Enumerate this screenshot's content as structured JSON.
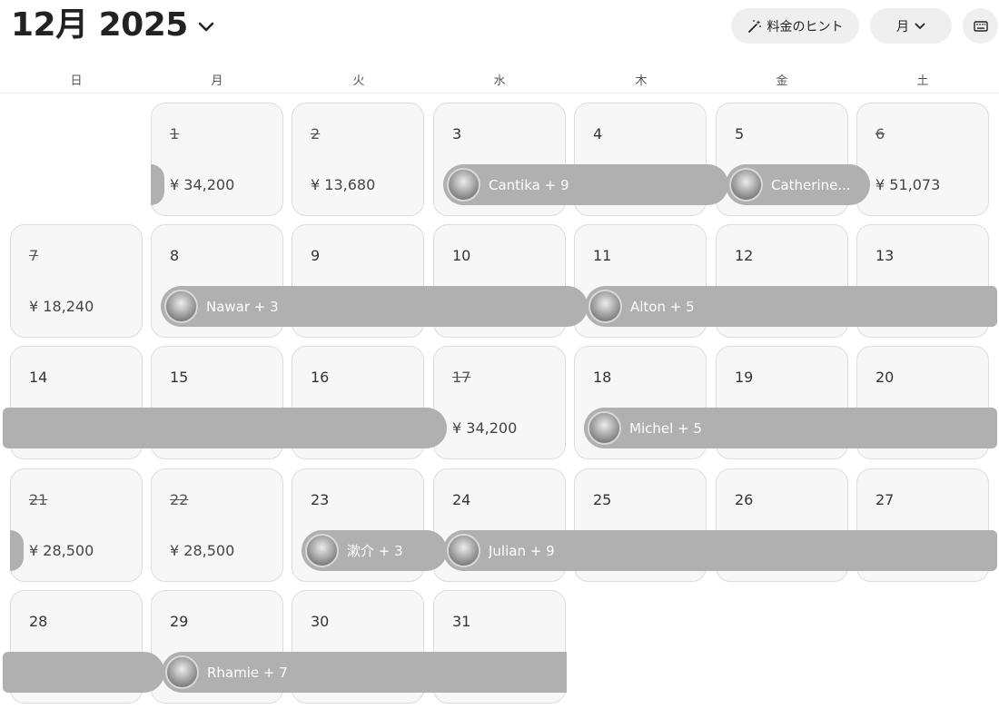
{
  "header": {
    "month_title": "12月 2025",
    "hint_button": "料金のヒント",
    "view_select": "月"
  },
  "weekdays": [
    "日",
    "月",
    "火",
    "水",
    "木",
    "金",
    "土"
  ],
  "days": [
    {
      "day": "1",
      "price": "¥ 34,200",
      "struck": true
    },
    {
      "day": "2",
      "price": "¥ 13,680",
      "struck": true
    },
    {
      "day": "3",
      "price": "",
      "struck": false
    },
    {
      "day": "4",
      "price": "",
      "struck": false
    },
    {
      "day": "5",
      "price": "",
      "struck": false
    },
    {
      "day": "6",
      "price": "¥ 51,073",
      "struck": true
    },
    {
      "day": "7",
      "price": "¥ 18,240",
      "struck": true
    },
    {
      "day": "8",
      "price": "",
      "struck": false
    },
    {
      "day": "9",
      "price": "",
      "struck": false
    },
    {
      "day": "10",
      "price": "",
      "struck": false
    },
    {
      "day": "11",
      "price": "",
      "struck": false
    },
    {
      "day": "12",
      "price": "",
      "struck": false
    },
    {
      "day": "13",
      "price": "",
      "struck": false
    },
    {
      "day": "14",
      "price": "",
      "struck": false
    },
    {
      "day": "15",
      "price": "",
      "struck": false
    },
    {
      "day": "16",
      "price": "",
      "struck": false
    },
    {
      "day": "17",
      "price": "¥ 34,200",
      "struck": true
    },
    {
      "day": "18",
      "price": "",
      "struck": false
    },
    {
      "day": "19",
      "price": "",
      "struck": false
    },
    {
      "day": "20",
      "price": "",
      "struck": false
    },
    {
      "day": "21",
      "price": "¥ 28,500",
      "struck": true
    },
    {
      "day": "22",
      "price": "¥ 28,500",
      "struck": true
    },
    {
      "day": "23",
      "price": "",
      "struck": false
    },
    {
      "day": "24",
      "price": "",
      "struck": false
    },
    {
      "day": "25",
      "price": "",
      "struck": false
    },
    {
      "day": "26",
      "price": "",
      "struck": false
    },
    {
      "day": "27",
      "price": "",
      "struck": false
    },
    {
      "day": "28",
      "price": "",
      "struck": false
    },
    {
      "day": "29",
      "price": "",
      "struck": false
    },
    {
      "day": "30",
      "price": "",
      "struck": false
    },
    {
      "day": "31",
      "price": "",
      "struck": false
    }
  ],
  "reservations": [
    {
      "guest": "",
      "has_avatar": false
    },
    {
      "guest": "Cantika + 9",
      "has_avatar": true
    },
    {
      "guest": "Catherine...",
      "has_avatar": true
    },
    {
      "guest": "Nawar + 3",
      "has_avatar": true
    },
    {
      "guest": "Alton + 5",
      "has_avatar": true
    },
    {
      "guest": "",
      "has_avatar": false
    },
    {
      "guest": "Michel + 5",
      "has_avatar": true
    },
    {
      "guest": "",
      "has_avatar": false
    },
    {
      "guest": "漱介 + 3",
      "has_avatar": true
    },
    {
      "guest": "Julian + 9",
      "has_avatar": true
    },
    {
      "guest": "",
      "has_avatar": false
    },
    {
      "guest": "Rhamie + 7",
      "has_avatar": true
    }
  ]
}
